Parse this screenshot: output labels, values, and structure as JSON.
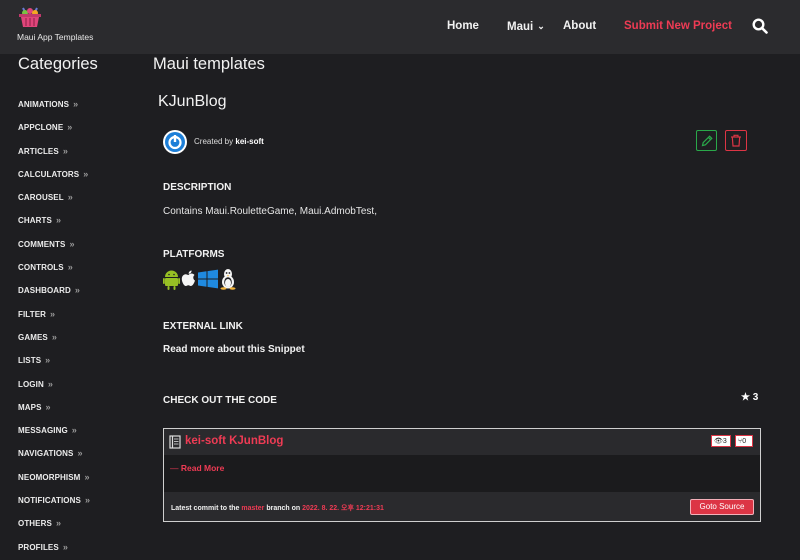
{
  "brand": {
    "name": "Maui App Templates",
    "icon": "basket-icon",
    "color": "#c0396b"
  },
  "nav": {
    "home": "Home",
    "maui": "Maui",
    "about": "About",
    "submit": "Submit New Project",
    "search_icon": "search-icon",
    "accent_color": "#ee3b54"
  },
  "sidebar": {
    "title": "Categories",
    "items": [
      {
        "label": "ANIMATIONS"
      },
      {
        "label": "APPCLONE"
      },
      {
        "label": "ARTICLES"
      },
      {
        "label": "CALCULATORS"
      },
      {
        "label": "CAROUSEL"
      },
      {
        "label": "CHARTS"
      },
      {
        "label": "COMMENTS"
      },
      {
        "label": "CONTROLS"
      },
      {
        "label": "DASHBOARD"
      },
      {
        "label": "FILTER"
      },
      {
        "label": "GAMES"
      },
      {
        "label": "LISTS"
      },
      {
        "label": "LOGIN"
      },
      {
        "label": "MAPS"
      },
      {
        "label": "MESSAGING"
      },
      {
        "label": "NAVIGATIONS"
      },
      {
        "label": "NEOMORPHISM"
      },
      {
        "label": "NOTIFICATIONS"
      },
      {
        "label": "OTHERS"
      },
      {
        "label": "PROFILES"
      }
    ]
  },
  "main": {
    "title": "Maui templates",
    "project_title": "KJunBlog",
    "created_by_prefix": "Created by",
    "author": "kei-soft",
    "description_heading": "DESCRIPTION",
    "description": "Contains Maui.RouletteGame, Maui.AdmobTest,",
    "platforms_heading": "PLATFORMS",
    "platforms": [
      "android-icon",
      "apple-icon",
      "windows-icon",
      "linux-icon"
    ],
    "external_heading": "EXTERNAL LINK",
    "external_link": "Read more about this Snippet",
    "code_heading": "CHECK OUT THE CODE",
    "stars": "3"
  },
  "repo": {
    "name": "kei-soft KJunBlog",
    "watchers": "3",
    "forks": "0",
    "read_more_prefix": "—",
    "read_more": "Read More",
    "commit_prefix": "Latest commit to the",
    "branch": "master",
    "commit_mid": "branch on",
    "commit_date": "2022. 8. 22. 오후 12:21:31",
    "goto": "Goto Source"
  }
}
